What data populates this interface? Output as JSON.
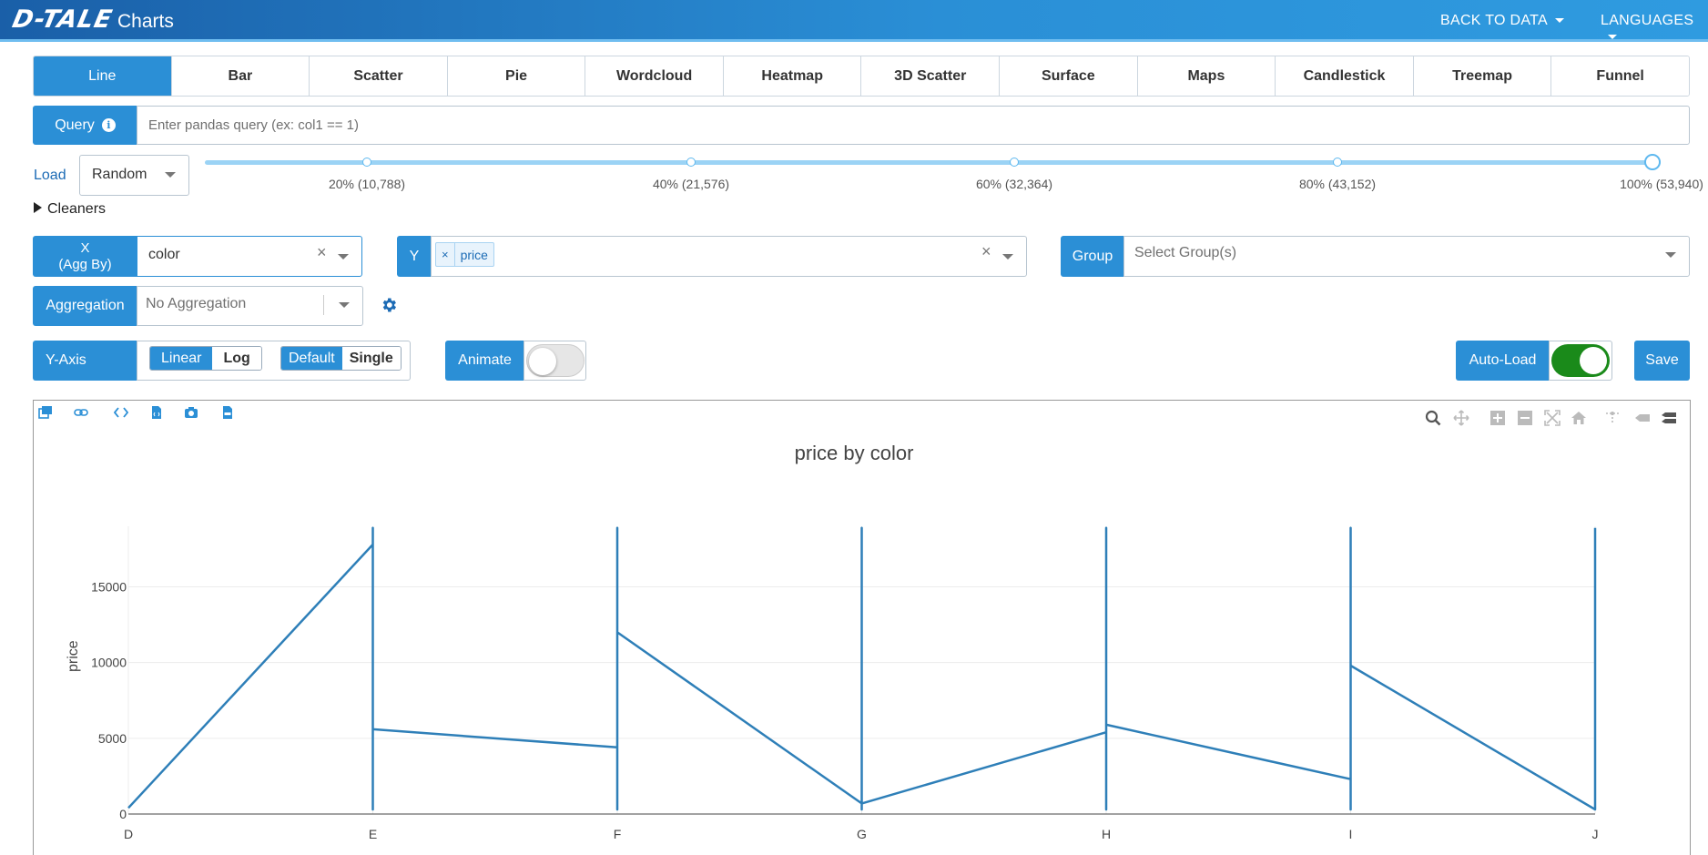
{
  "navbar": {
    "logo": "D-TALE",
    "title": "Charts",
    "back_to_data": "BACK TO DATA",
    "languages": "LANGUAGES"
  },
  "tabs": [
    {
      "label": "Line",
      "active": true
    },
    {
      "label": "Bar"
    },
    {
      "label": "Scatter"
    },
    {
      "label": "Pie"
    },
    {
      "label": "Wordcloud"
    },
    {
      "label": "Heatmap"
    },
    {
      "label": "3D Scatter"
    },
    {
      "label": "Surface"
    },
    {
      "label": "Maps"
    },
    {
      "label": "Candlestick"
    },
    {
      "label": "Treemap"
    },
    {
      "label": "Funnel"
    }
  ],
  "query": {
    "label": "Query",
    "placeholder": "Enter pandas query (ex: col1 == 1)",
    "value": ""
  },
  "load": {
    "label": "Load",
    "selected": "Random",
    "slider_value_pct": 100,
    "marks": [
      "20% (10,788)",
      "40% (21,576)",
      "60% (32,364)",
      "80% (43,152)",
      "100% (53,940)"
    ]
  },
  "cleaners": {
    "label": "Cleaners"
  },
  "x_axis": {
    "label_line1": "X",
    "label_line2": "(Agg By)",
    "value": "color"
  },
  "y_axis_select": {
    "label": "Y",
    "values": [
      "price"
    ]
  },
  "group": {
    "label": "Group",
    "placeholder": "Select Group(s)"
  },
  "aggregation": {
    "label": "Aggregation",
    "placeholder": "No Aggregation"
  },
  "yaxis_options": {
    "label": "Y-Axis",
    "scale": [
      "Linear",
      "Log"
    ],
    "scale_selected": "Linear",
    "mode": [
      "Default",
      "Single"
    ],
    "mode_selected": "Default"
  },
  "animate": {
    "label": "Animate",
    "enabled": false
  },
  "autoload": {
    "label": "Auto-Load",
    "enabled": true
  },
  "save": {
    "label": "Save"
  },
  "colors": {
    "primary": "#2b8fd6",
    "line": "#2e7fb8",
    "toggle_on": "#1a8a1a",
    "toggle_off": "#e6e6e6"
  },
  "chart_data": {
    "type": "line",
    "title": "price by color",
    "xlabel": "",
    "ylabel": "price",
    "categories": [
      "D",
      "E",
      "F",
      "G",
      "H",
      "I",
      "J"
    ],
    "ylim": [
      0,
      19000
    ],
    "yticks": [
      0,
      5000,
      10000,
      15000
    ],
    "grid": true,
    "series": [
      {
        "points": [
          [
            "D",
            400
          ],
          [
            "E",
            17800
          ],
          [
            "E",
            18900
          ],
          [
            "E",
            300
          ],
          [
            "E",
            5600
          ],
          [
            "F",
            4400
          ],
          [
            "F",
            18900
          ],
          [
            "F",
            300
          ],
          [
            "F",
            12000
          ],
          [
            "G",
            700
          ],
          [
            "G",
            18900
          ],
          [
            "G",
            300
          ],
          [
            "G",
            700
          ],
          [
            "H",
            5400
          ],
          [
            "H",
            18900
          ],
          [
            "H",
            300
          ],
          [
            "H",
            5900
          ],
          [
            "I",
            2300
          ],
          [
            "I",
            18900
          ],
          [
            "I",
            300
          ],
          [
            "I",
            9800
          ],
          [
            "J",
            300
          ],
          [
            "J",
            18900
          ]
        ]
      }
    ]
  }
}
